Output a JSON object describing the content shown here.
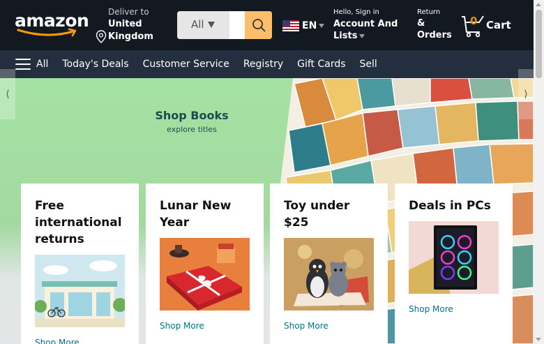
{
  "header": {
    "logo_text": "amazon",
    "deliver": {
      "small": "Deliver to",
      "location": "United Kingdom"
    },
    "search": {
      "category": "All",
      "placeholder": ""
    },
    "language": {
      "code": "EN"
    },
    "account": {
      "small": "Hello, Sign in",
      "big": "Account And Lists"
    },
    "returns": {
      "small": "Return",
      "big": "& Orders"
    },
    "cart": {
      "count": "0",
      "label": "Cart"
    }
  },
  "nav": {
    "all_label": "All",
    "items": [
      "Today's Deals",
      "Customer Service",
      "Registry",
      "Gift Cards",
      "Sell"
    ]
  },
  "hero": {
    "title": "Shop Books",
    "subtitle": "explore titles",
    "prev_arrow": "⟨",
    "next_arrow": "⟩"
  },
  "cards": [
    {
      "title": "Free international returns",
      "link": "Shop More"
    },
    {
      "title": "Lunar New Year",
      "link": "Shop More"
    },
    {
      "title": "Toy under $25",
      "link": "Shop More"
    },
    {
      "title": "Deals in PCs",
      "link": "Shop More"
    }
  ],
  "colors": {
    "nav_top": "#131921",
    "nav_bottom": "#232f3e",
    "search_button": "#febd69",
    "cart_count": "#f08804",
    "link": "#007185"
  }
}
